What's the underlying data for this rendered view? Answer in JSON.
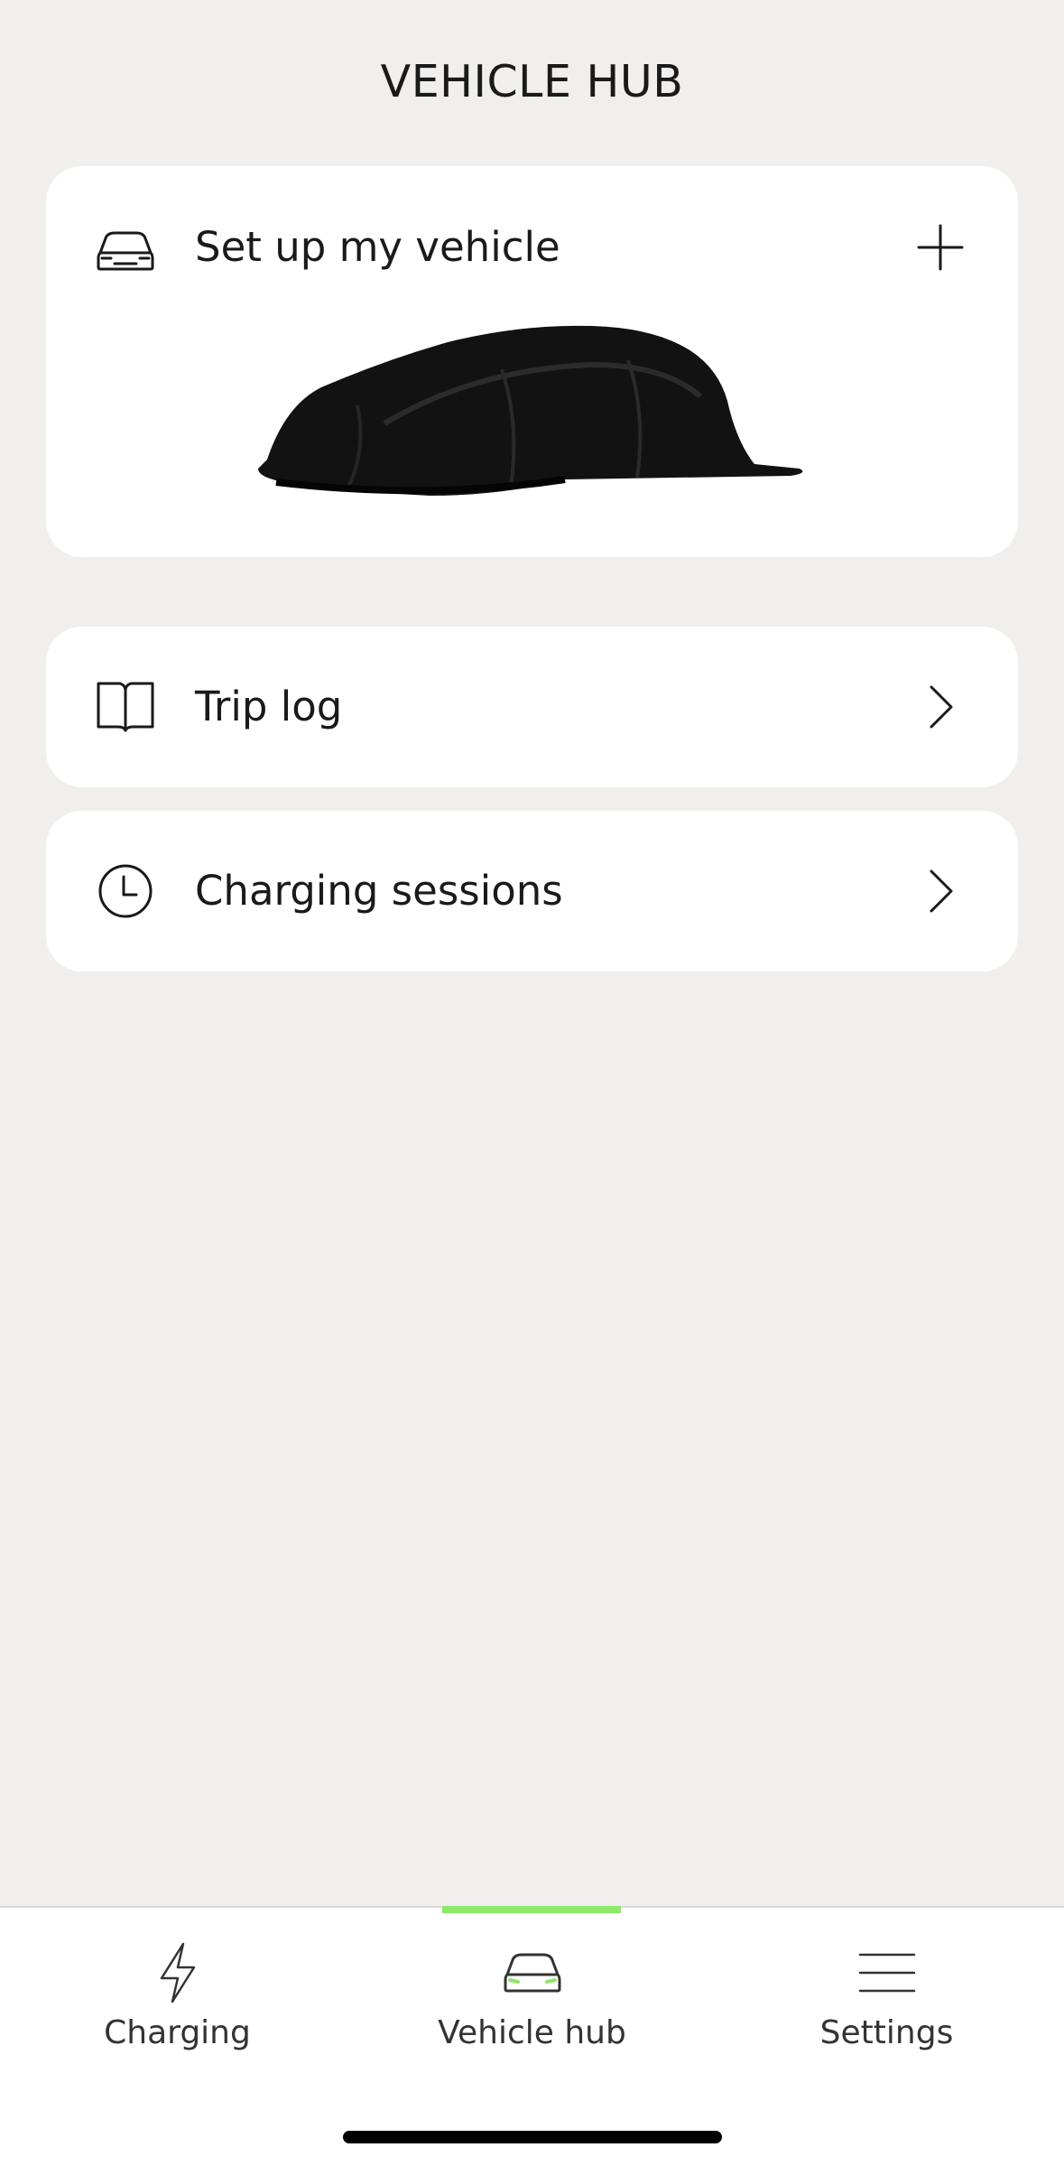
{
  "header": {
    "title": "VEHICLE HUB"
  },
  "main": {
    "setup_card": {
      "label": "Set up my vehicle",
      "icon": "car-icon",
      "action_icon": "plus-icon",
      "illustration": "covered-car-image"
    },
    "rows": [
      {
        "label": "Trip log",
        "icon": "book-icon",
        "action_icon": "chevron-right-icon"
      },
      {
        "label": "Charging sessions",
        "icon": "clock-icon",
        "action_icon": "chevron-right-icon"
      }
    ]
  },
  "bottom_nav": {
    "items": [
      {
        "label": "Charging",
        "icon": "lightning-icon",
        "active": false
      },
      {
        "label": "Vehicle hub",
        "icon": "car-icon",
        "active": true
      },
      {
        "label": "Settings",
        "icon": "menu-icon",
        "active": false
      }
    ],
    "active_color": "#8ee86a"
  },
  "colors": {
    "background": "#f0efed",
    "card": "#ffffff",
    "text": "#1a1a1a",
    "accent": "#8ee86a"
  }
}
